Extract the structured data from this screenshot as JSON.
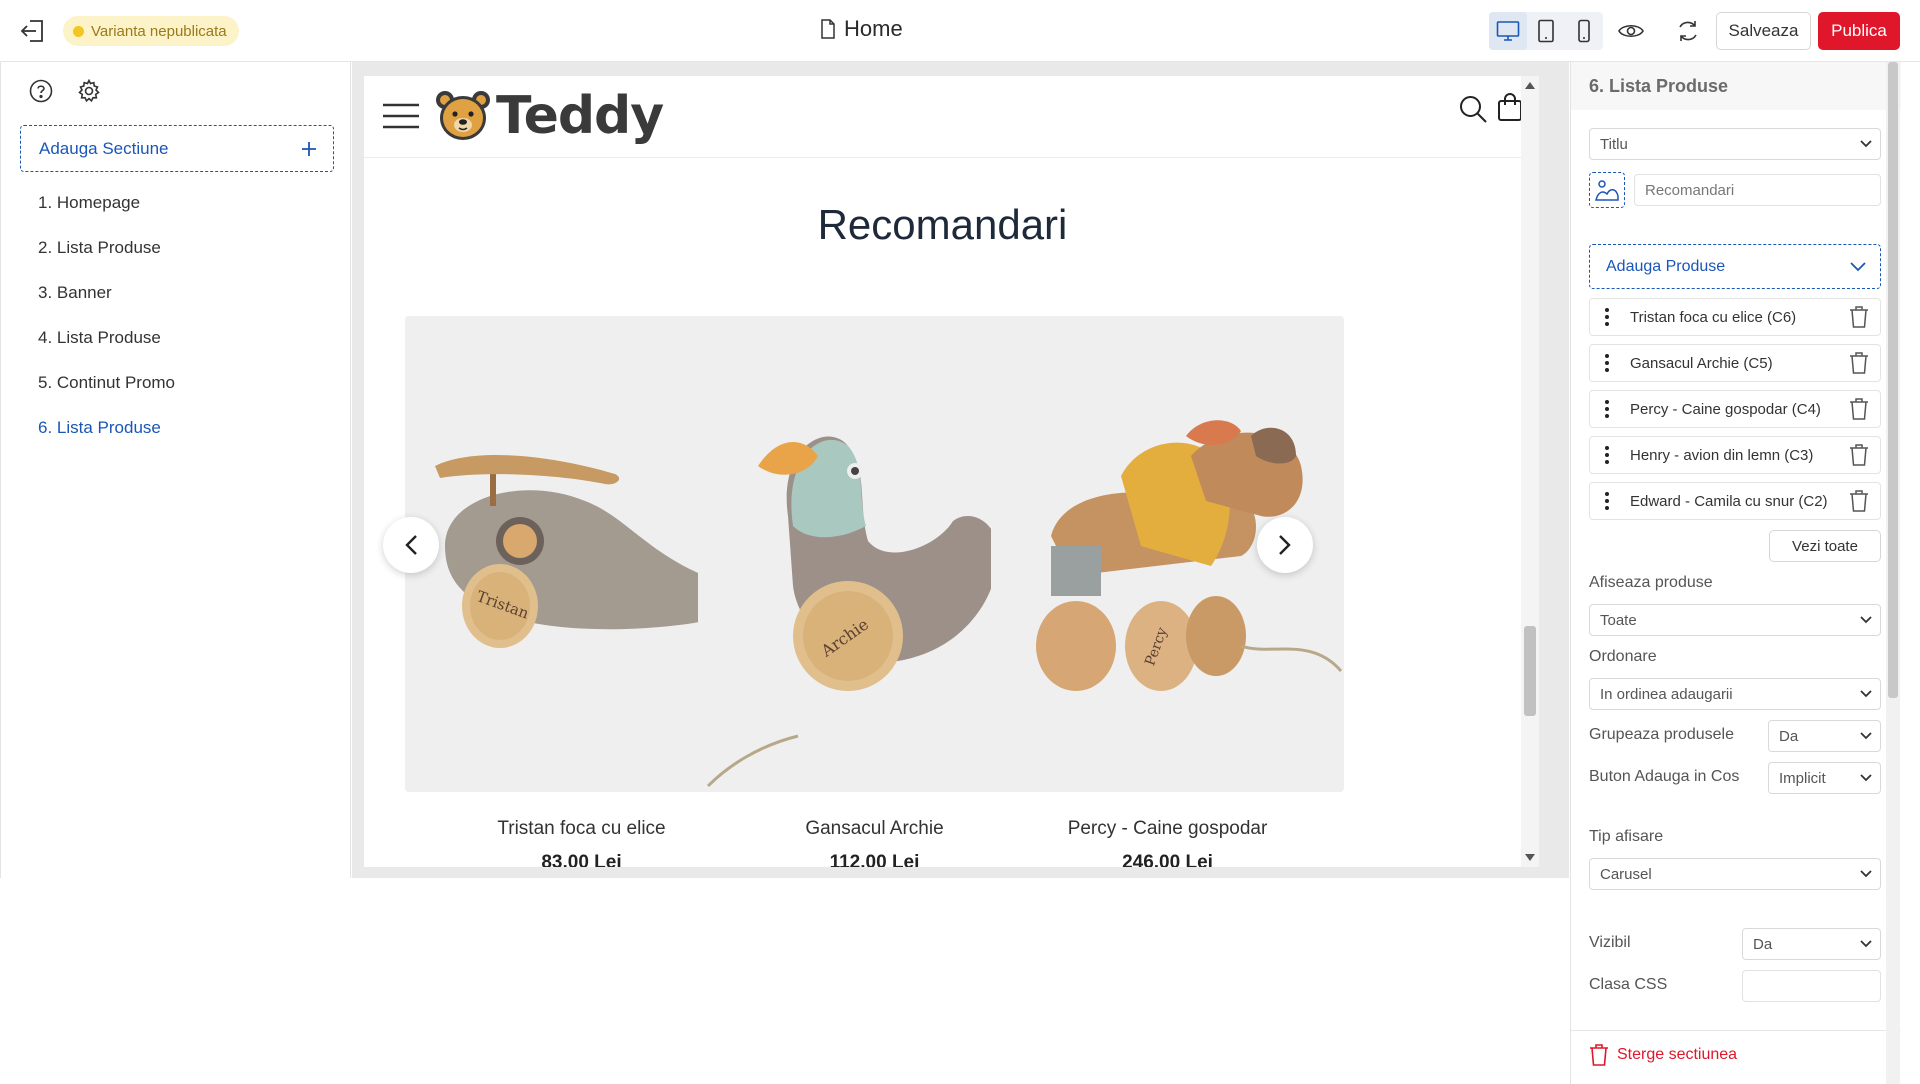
{
  "topbar": {
    "status": "Varianta nepublicata",
    "doc_title": "Home",
    "save_label": "Salveaza",
    "publish_label": "Publica",
    "icons": [
      "exit-icon",
      "file-icon",
      "desktop-icon",
      "tablet-icon",
      "mobile-icon",
      "eye-icon",
      "sync-icon"
    ],
    "colors": {
      "publish": "#e0162b",
      "accent": "#1a56b8",
      "status_bg": "#fdf3c8",
      "status_dot": "#f3c623"
    }
  },
  "sidebar": {
    "add_section_label": "Adauga Sectiune",
    "sections": [
      {
        "label": "1. Homepage",
        "active": false
      },
      {
        "label": "2. Lista Produse",
        "active": false
      },
      {
        "label": "3. Banner",
        "active": false
      },
      {
        "label": "4. Lista Produse",
        "active": false
      },
      {
        "label": "5. Continut Promo",
        "active": false
      },
      {
        "label": "6. Lista Produse",
        "active": true
      }
    ]
  },
  "preview": {
    "logo_text": "Teddy",
    "section_title": "Recomandari",
    "products": [
      {
        "name": "Tristan foca cu elice",
        "price": "83,00 Lei"
      },
      {
        "name": "Gansacul Archie",
        "price": "112,00 Lei"
      },
      {
        "name": "Percy - Caine gospodar",
        "price": "246,00 Lei"
      }
    ]
  },
  "panel": {
    "title": "6. Lista Produse",
    "heading_type": "Titlu",
    "heading_text": "Recomandari",
    "add_products_label": "Adauga Produse",
    "products": [
      "Tristan foca cu elice (C6)",
      "Gansacul Archie (C5)",
      "Percy - Caine gospodar (C4)",
      "Henry - avion din lemn (C3)",
      "Edward - Camila cu snur (C2)"
    ],
    "see_all_label": "Vezi toate",
    "show_products_label": "Afiseaza produse",
    "show_products_value": "Toate",
    "order_label": "Ordonare",
    "order_value": "In ordinea adaugarii",
    "group_label": "Grupeaza produsele",
    "group_value": "Da",
    "cart_button_label": "Buton Adauga in Cos",
    "cart_button_value": "Implicit",
    "display_type_label": "Tip afisare",
    "display_type_value": "Carusel",
    "visible_label": "Vizibil",
    "visible_value": "Da",
    "css_class_label": "Clasa CSS",
    "css_class_value": "",
    "delete_label": "Sterge sectiunea"
  }
}
